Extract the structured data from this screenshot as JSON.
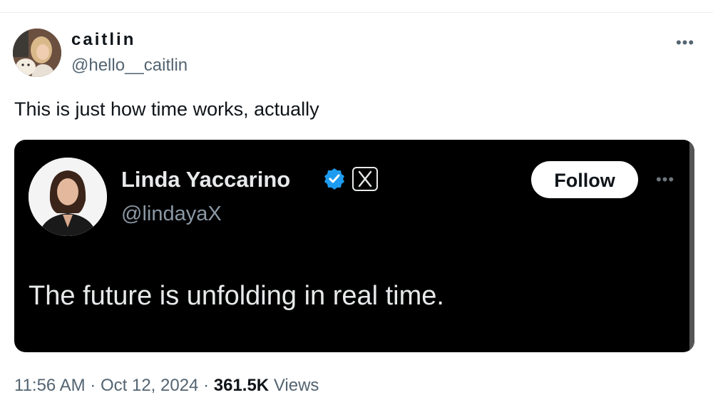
{
  "tweet": {
    "author": {
      "name": "caitlin",
      "handle": "@hello__caitlin"
    },
    "more_icon": "more-horizontal-icon",
    "text": "This is just how time works, actually",
    "timestamp": "11:56 AM",
    "separator": "·",
    "date": "Oct 12, 2024",
    "views_count": "361.5K",
    "views_label": "Views"
  },
  "quoted": {
    "author": {
      "name": "Linda Yaccarino",
      "handle": "@lindayaX",
      "verified_icon": "verified-badge-icon",
      "affiliation_icon": "x-logo-icon"
    },
    "follow_label": "Follow",
    "more_icon": "more-horizontal-icon",
    "text": "The future is unfolding in real time."
  },
  "colors": {
    "card_background": "#000000",
    "verified_blue": "#1d9bf0",
    "secondary_text": "#536471"
  }
}
